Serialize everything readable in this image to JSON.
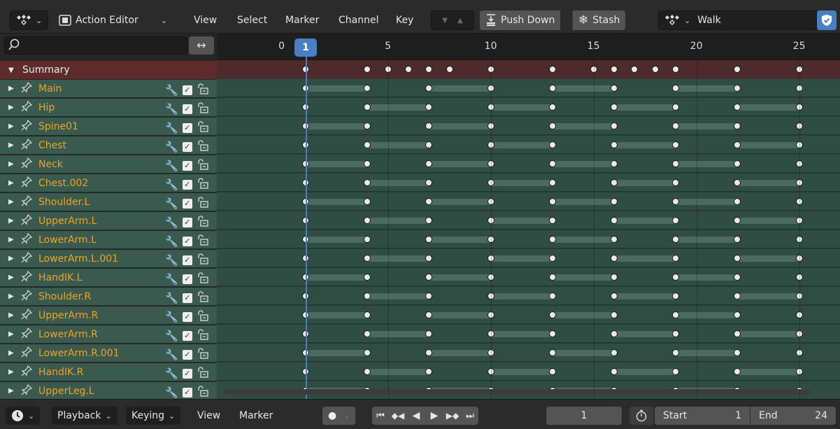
{
  "header": {
    "editor_type": "Action Editor",
    "menus": [
      "View",
      "Select",
      "Marker",
      "Channel",
      "Key"
    ],
    "push_down_label": "Push Down",
    "stash_label": "Stash",
    "action_name": "Walk"
  },
  "search": {
    "placeholder": ""
  },
  "ruler": {
    "ticks": [
      "0",
      "5",
      "10",
      "15",
      "20",
      "25"
    ],
    "current_frame": "1"
  },
  "summary": {
    "label": "Summary",
    "keyframes": [
      1,
      4,
      5,
      6,
      7,
      8,
      10,
      13,
      15,
      16,
      17,
      18,
      19,
      22,
      25
    ]
  },
  "channels": [
    {
      "name": "Main",
      "keyframes": [
        1,
        4,
        7,
        10,
        13,
        16,
        19,
        22,
        25
      ]
    },
    {
      "name": "Hip",
      "keyframes": [
        1,
        4,
        7,
        10,
        13,
        16,
        19,
        22,
        25
      ]
    },
    {
      "name": "Spine01",
      "keyframes": [
        1,
        4,
        7,
        10,
        13,
        16,
        19,
        22,
        25
      ]
    },
    {
      "name": "Chest",
      "keyframes": [
        1,
        4,
        7,
        10,
        13,
        16,
        19,
        22,
        25
      ]
    },
    {
      "name": "Neck",
      "keyframes": [
        1,
        4,
        7,
        10,
        13,
        16,
        19,
        22,
        25
      ]
    },
    {
      "name": "Chest.002",
      "keyframes": [
        1,
        4,
        7,
        10,
        13,
        16,
        19,
        22,
        25
      ]
    },
    {
      "name": "Shoulder.L",
      "keyframes": [
        1,
        4,
        7,
        10,
        13,
        16,
        19,
        22,
        25
      ]
    },
    {
      "name": "UpperArm.L",
      "keyframes": [
        1,
        4,
        7,
        10,
        13,
        16,
        19,
        22,
        25
      ]
    },
    {
      "name": "LowerArm.L",
      "keyframes": [
        1,
        4,
        7,
        10,
        13,
        16,
        19,
        22,
        25
      ]
    },
    {
      "name": "LowerArm.L.001",
      "keyframes": [
        1,
        4,
        7,
        10,
        13,
        16,
        19,
        22,
        25
      ]
    },
    {
      "name": "HandIK.L",
      "keyframes": [
        1,
        4,
        7,
        10,
        13,
        16,
        19,
        22,
        25
      ]
    },
    {
      "name": "Shoulder.R",
      "keyframes": [
        1,
        4,
        7,
        10,
        13,
        16,
        19,
        22,
        25
      ]
    },
    {
      "name": "UpperArm.R",
      "keyframes": [
        1,
        4,
        7,
        10,
        13,
        16,
        19,
        22,
        25
      ]
    },
    {
      "name": "LowerArm.R",
      "keyframes": [
        1,
        4,
        7,
        10,
        13,
        16,
        19,
        22,
        25
      ]
    },
    {
      "name": "LowerArm.R.001",
      "keyframes": [
        1,
        4,
        7,
        10,
        13,
        16,
        19,
        22,
        25
      ]
    },
    {
      "name": "HandIK.R",
      "keyframes": [
        1,
        4,
        7,
        10,
        13,
        16,
        19,
        22,
        25
      ]
    },
    {
      "name": "UpperLeg.L",
      "keyframes": [
        1,
        4,
        7,
        10,
        13,
        16,
        19,
        22,
        25
      ]
    }
  ],
  "footer": {
    "playback_label": "Playback",
    "keying_label": "Keying",
    "view_label": "View",
    "marker_label": "Marker",
    "current_frame": "1",
    "start_label": "Start",
    "start_value": "1",
    "end_label": "End",
    "end_value": "24"
  },
  "colors": {
    "accent": "#4a7fc4",
    "channel_name": "#f0a321",
    "summary_bg": "#5f2a2a",
    "group_bg": "#3a5a4f"
  }
}
